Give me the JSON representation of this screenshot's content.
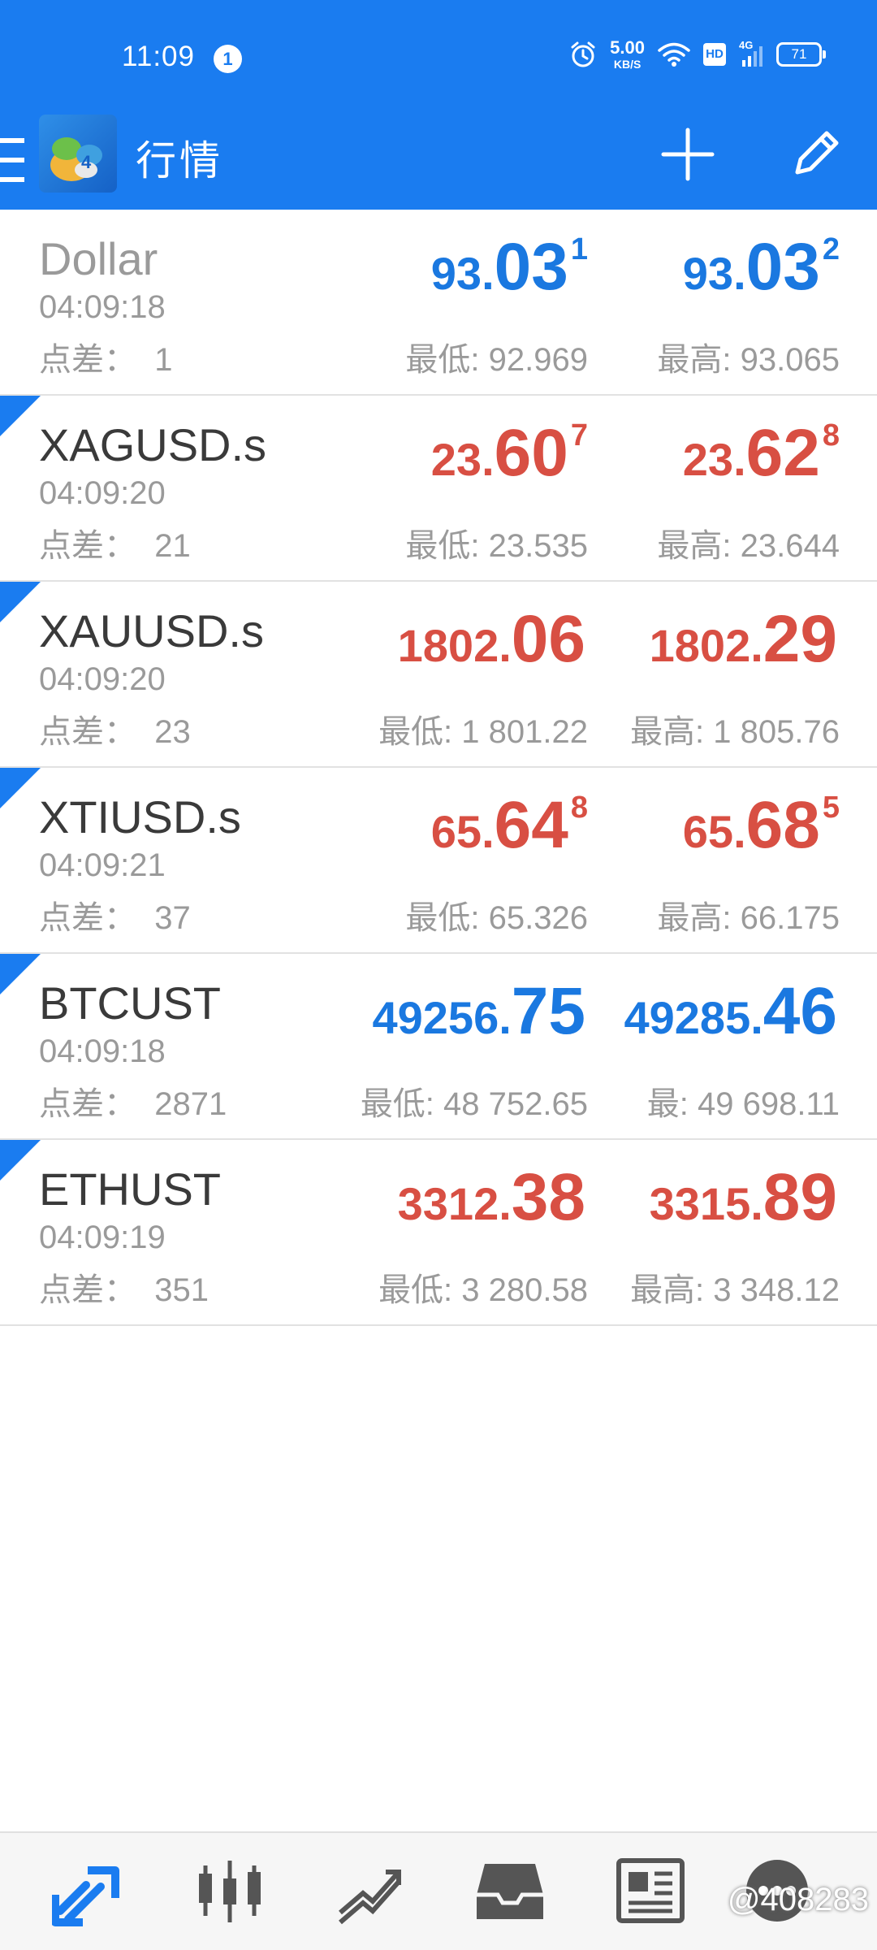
{
  "status_bar": {
    "time": "11:09",
    "notification_count": "1",
    "net_speed_value": "5.00",
    "net_speed_unit": "KB/S",
    "hd_label": "HD",
    "network_label": "4G",
    "battery_level": "71"
  },
  "app_bar": {
    "title": "行情",
    "icons": [
      "menu-icon",
      "metatrader-logo",
      "plus-icon",
      "pencil-icon"
    ]
  },
  "colors": {
    "primary": "#1a7cf0",
    "price_up": "#1a78e0",
    "price_down": "#d84f43",
    "muted_text": "#9a9a9a"
  },
  "quotes": [
    {
      "symbol": "Dollar",
      "time": "04:09:18",
      "spread": "点差：  1",
      "direction": "up",
      "bid": {
        "small": "93.",
        "big": "03",
        "sup": "1"
      },
      "ask": {
        "small": "93.",
        "big": "03",
        "sup": "2"
      },
      "low": "最低: 92.969",
      "high": "最高: 93.065"
    },
    {
      "symbol": "XAGUSD.s",
      "time": "04:09:20",
      "spread": "点差：  21",
      "direction": "down",
      "bid": {
        "small": "23.",
        "big": "60",
        "sup": "7"
      },
      "ask": {
        "small": "23.",
        "big": "62",
        "sup": "8"
      },
      "low": "最低: 23.535",
      "high": "最高: 23.644"
    },
    {
      "symbol": "XAUUSD.s",
      "time": "04:09:20",
      "spread": "点差：  23",
      "direction": "down",
      "bid": {
        "small": "1802.",
        "big": "06",
        "sup": ""
      },
      "ask": {
        "small": "1802.",
        "big": "29",
        "sup": ""
      },
      "low": "最低: 1 801.22",
      "high": "最高: 1 805.76"
    },
    {
      "symbol": "XTIUSD.s",
      "time": "04:09:21",
      "spread": "点差：  37",
      "direction": "down",
      "bid": {
        "small": "65.",
        "big": "64",
        "sup": "8"
      },
      "ask": {
        "small": "65.",
        "big": "68",
        "sup": "5"
      },
      "low": "最低: 65.326",
      "high": "最高: 66.175"
    },
    {
      "symbol": "BTCUST",
      "time": "04:09:18",
      "spread": "点差：  2871",
      "direction": "up",
      "bid": {
        "small": "49256.",
        "big": "75",
        "sup": ""
      },
      "ask": {
        "small": "49285.",
        "big": "46",
        "sup": ""
      },
      "low": "最低: 48 752.65",
      "high": "最: 49 698.11"
    },
    {
      "symbol": "ETHUST",
      "time": "04:09:19",
      "spread": "点差：  351",
      "direction": "down",
      "bid": {
        "small": "3312.",
        "big": "38",
        "sup": ""
      },
      "ask": {
        "small": "3315.",
        "big": "89",
        "sup": ""
      },
      "low": "最低: 3 280.58",
      "high": "最高: 3 348.12"
    }
  ],
  "bottom_nav": {
    "items": [
      "quotes-icon",
      "chart-icon",
      "trade-icon",
      "history-icon",
      "news-icon",
      "chat-icon"
    ],
    "active": "quotes-icon",
    "watermark": "@408283"
  }
}
